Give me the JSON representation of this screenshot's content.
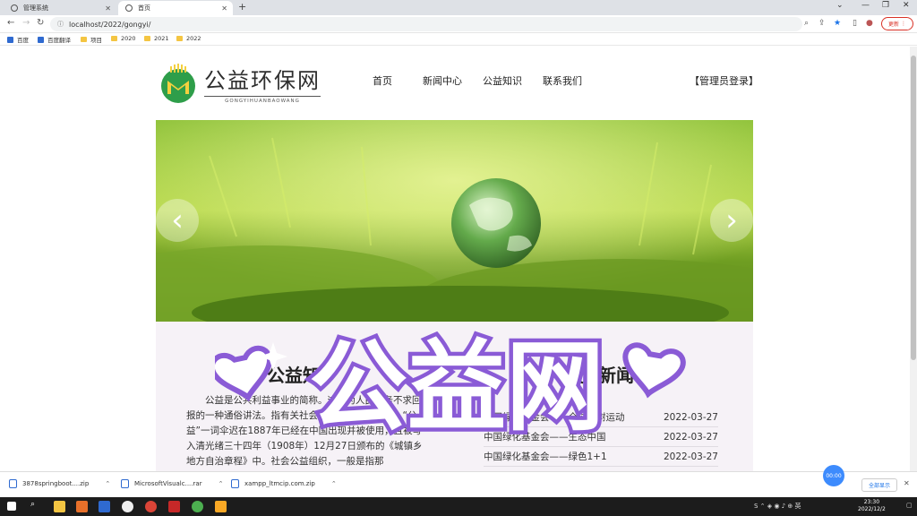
{
  "browser": {
    "tabs": [
      {
        "title": "管理系统",
        "active": false
      },
      {
        "title": "首页",
        "active": true
      }
    ],
    "url": "localhost/2022/gongyi/",
    "update_label": "更新",
    "bookmarks": [
      "百度",
      "百度翻译",
      "项目",
      "2020",
      "2021",
      "2022"
    ]
  },
  "site": {
    "logo_title": "公益环保网",
    "logo_subtitle": "GONGYIHUANBAOWANG",
    "nav": [
      "首页",
      "新闻中心",
      "公益知识",
      "联系我们"
    ],
    "admin_login": "【管理员登录】"
  },
  "banner": {
    "prev_icon": "chevron-left-icon",
    "next_icon": "chevron-right-icon"
  },
  "content": {
    "knowledge_title": "公益知",
    "news_title_part1": "最",
    "news_title_part2": "新闻",
    "intro_text": "公益是公共利益事业的简称。这是为人民服务不求回报的一种通俗讲法。指有关社会公众的福祉和利益。“公益”一词伞迟在1887年已经在中国出现并被使用，且被写入清光绪三十四年（1908年）12月27日颁布的《城镇乡地方自治章程》中。社会公益组织，一般是指那",
    "news": [
      {
        "title": "中国绿化基金会——全球绿树运动",
        "date": "2022-03-27"
      },
      {
        "title": "中国绿化基金会——生态中国",
        "date": "2022-03-27"
      },
      {
        "title": "中国绿化基金会——绿色1+1",
        "date": "2022-03-27"
      }
    ]
  },
  "overlay": {
    "text": "公益网"
  },
  "downloads": [
    {
      "name": "3878springboot....zip"
    },
    {
      "name": "MicrosoftVisualc....rar"
    },
    {
      "name": "xampp_ltmcip.com.zip"
    }
  ],
  "downloads_show_all": "全部显示",
  "timer_badge": "00:00",
  "taskbar": {
    "time": "23:30",
    "date": "2022/12/2"
  },
  "colors": {
    "accent_green": "#4caf50",
    "overlay_purple": "#8a5bd6"
  }
}
